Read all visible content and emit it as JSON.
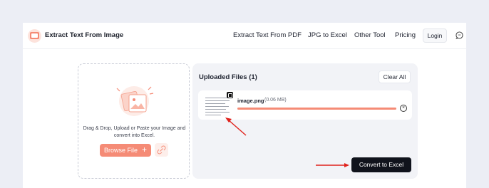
{
  "header": {
    "brand": "Extract Text From Image",
    "nav": [
      "Extract Text From PDF",
      "JPG to Excel",
      "Other Tool",
      "Pricing"
    ],
    "login_label": "Login",
    "icons": {
      "logo": "image-logo-icon",
      "chat": "chat-bubble-icon"
    }
  },
  "dropzone": {
    "instructions": "Drag & Drop, Upload or Paste your Image and convert into Excel.",
    "browse_label": "Browse File",
    "browse_plus": "+",
    "icons": {
      "illustration": "image-upload-illustration",
      "link": "link-icon"
    }
  },
  "uploaded": {
    "title": "Uploaded Files (1)",
    "clear_label": "Clear All",
    "files": [
      {
        "name": "image.png",
        "size": "(0.06 MB)",
        "progress": 1.0
      }
    ],
    "close_glyph": "×",
    "convert_label": "Convert to Excel"
  },
  "colors": {
    "accent": "#f58b76",
    "accent_light": "#fde3dc",
    "dark_button": "#10131c",
    "annotation_arrow": "#e0211b",
    "background": "#eceef5"
  }
}
